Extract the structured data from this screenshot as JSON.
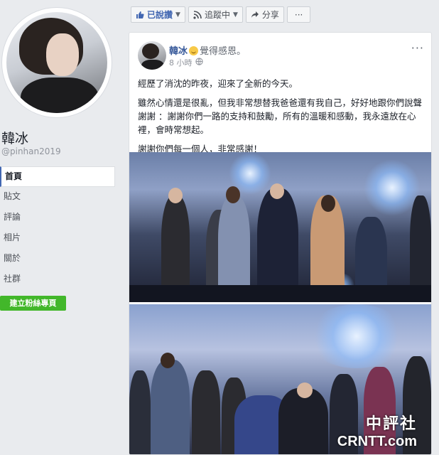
{
  "profile": {
    "name": "韓冰",
    "handle": "@pinhan2019"
  },
  "nav": {
    "items": [
      {
        "label": "首頁",
        "active": true
      },
      {
        "label": "貼文",
        "active": false
      },
      {
        "label": "評論",
        "active": false
      },
      {
        "label": "相片",
        "active": false
      },
      {
        "label": "關於",
        "active": false
      },
      {
        "label": "社群",
        "active": false
      }
    ],
    "create_page_label": "建立粉絲專頁"
  },
  "action_bar": {
    "liked_label": "已說讚",
    "following_label": "追蹤中",
    "share_label": "分享",
    "more_label": "···"
  },
  "post": {
    "author": "韓冰",
    "feeling": "覺得感恩。",
    "time": "8 小時",
    "visibility_icon": "globe-icon",
    "more_label": "···",
    "paragraphs": [
      "經歷了消沈的昨夜，迎來了全新的今天。",
      "雖然心情還是很亂，但我非常想替我爸爸還有我自己，好好地跟你們說聲謝謝 ：謝謝你們一路的支持和鼓勵，所有的溫暖和感動，我永遠放在心裡，會時常想起。",
      "謝謝你們每一個人，非常感謝！"
    ]
  },
  "watermark": {
    "top": "中評社",
    "bottom": "CRNTT.com"
  },
  "colors": {
    "fb_blue": "#4267b2",
    "link_blue": "#365899",
    "green": "#42b72a",
    "background": "#e9ebee"
  }
}
